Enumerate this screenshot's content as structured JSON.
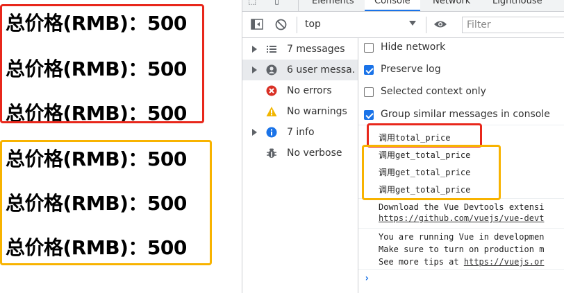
{
  "page": {
    "price_lines": [
      "总价格(RMB)：500",
      "总价格(RMB)：500",
      "总价格(RMB)：500",
      "总价格(RMB)：500",
      "总价格(RMB)：500",
      "总价格(RMB)：500"
    ]
  },
  "devtools": {
    "tabs": [
      "Elements",
      "Console",
      "Network",
      "Lighthouse"
    ],
    "active_tab": "Console",
    "toolbar": {
      "context": "top",
      "filter_placeholder": "Filter"
    },
    "sidebar": [
      {
        "label": "7 messages",
        "icon": "list-icon",
        "expandable": true
      },
      {
        "label": "6 user messa...",
        "icon": "user-icon",
        "expandable": true,
        "selected": true
      },
      {
        "label": "No errors",
        "icon": "error-icon",
        "expandable": false
      },
      {
        "label": "No warnings",
        "icon": "warning-icon",
        "expandable": false
      },
      {
        "label": "7 info",
        "icon": "info-icon",
        "expandable": true
      },
      {
        "label": "No verbose",
        "icon": "bug-icon",
        "expandable": false
      }
    ],
    "options": [
      {
        "label": "Hide network",
        "checked": false
      },
      {
        "label": "Preserve log",
        "checked": true
      },
      {
        "label": "Selected context only",
        "checked": false
      },
      {
        "label": "Group similar messages in console",
        "checked": true
      }
    ],
    "logs": {
      "call_total": "调用total_price",
      "call_get": [
        "调用get_total_price",
        "调用get_total_price",
        "调用get_total_price"
      ],
      "devtools_msg": "Download the Vue Devtools extensi",
      "devtools_link": "https://github.com/vuejs/vue-devt",
      "dev_mode_1": "You are running Vue in developmen",
      "dev_mode_2": "Make sure to turn on production m",
      "dev_mode_3_prefix": "See more tips at ",
      "dev_mode_3_link": "https://vuejs.or"
    },
    "prompt": "›"
  },
  "colors": {
    "red_annotation": "#e8271b",
    "yellow_annotation": "#f8b300",
    "accent": "#1a73e8"
  }
}
